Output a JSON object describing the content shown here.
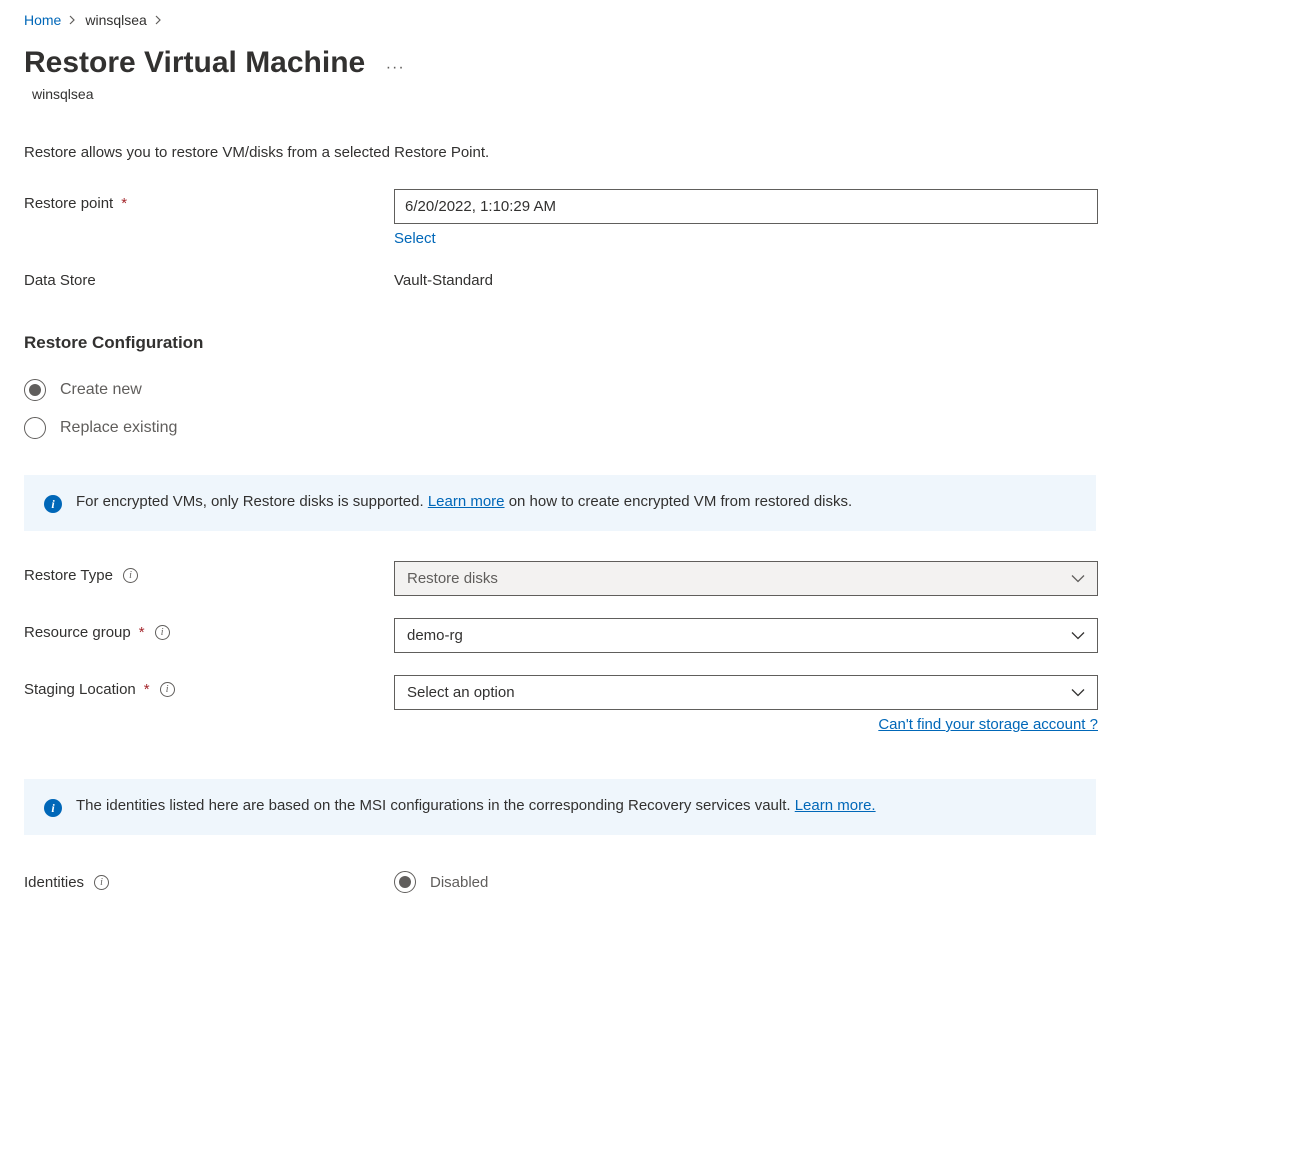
{
  "breadcrumb": {
    "home": "Home",
    "vm": "winsqlsea"
  },
  "header": {
    "title": "Restore Virtual Machine",
    "subtitle": "winsqlsea"
  },
  "description": "Restore allows you to restore VM/disks from a selected Restore Point.",
  "fields": {
    "restore_point_label": "Restore point",
    "restore_point_value": "6/20/2022, 1:10:29 AM",
    "select_link": "Select",
    "data_store_label": "Data Store",
    "data_store_value": "Vault-Standard",
    "restore_type_label": "Restore Type",
    "restore_type_value": "Restore disks",
    "resource_group_label": "Resource group",
    "resource_group_value": "demo-rg",
    "staging_location_label": "Staging Location",
    "staging_location_value": "Select an option",
    "cant_find_link": "Can't find your storage account ?",
    "identities_label": "Identities",
    "identities_value": "Disabled"
  },
  "section": {
    "restore_config": "Restore Configuration"
  },
  "radios": {
    "create_new": "Create new",
    "replace_existing": "Replace existing"
  },
  "banners": {
    "encrypted_text_pre": "For encrypted VMs, only Restore disks is supported. ",
    "encrypted_link": "Learn more",
    "encrypted_text_post": " on how to create encrypted VM from restored disks.",
    "identities_text_pre": "The identities listed here are based on the MSI configurations in the corresponding Recovery services vault. ",
    "identities_link": "Learn more."
  }
}
